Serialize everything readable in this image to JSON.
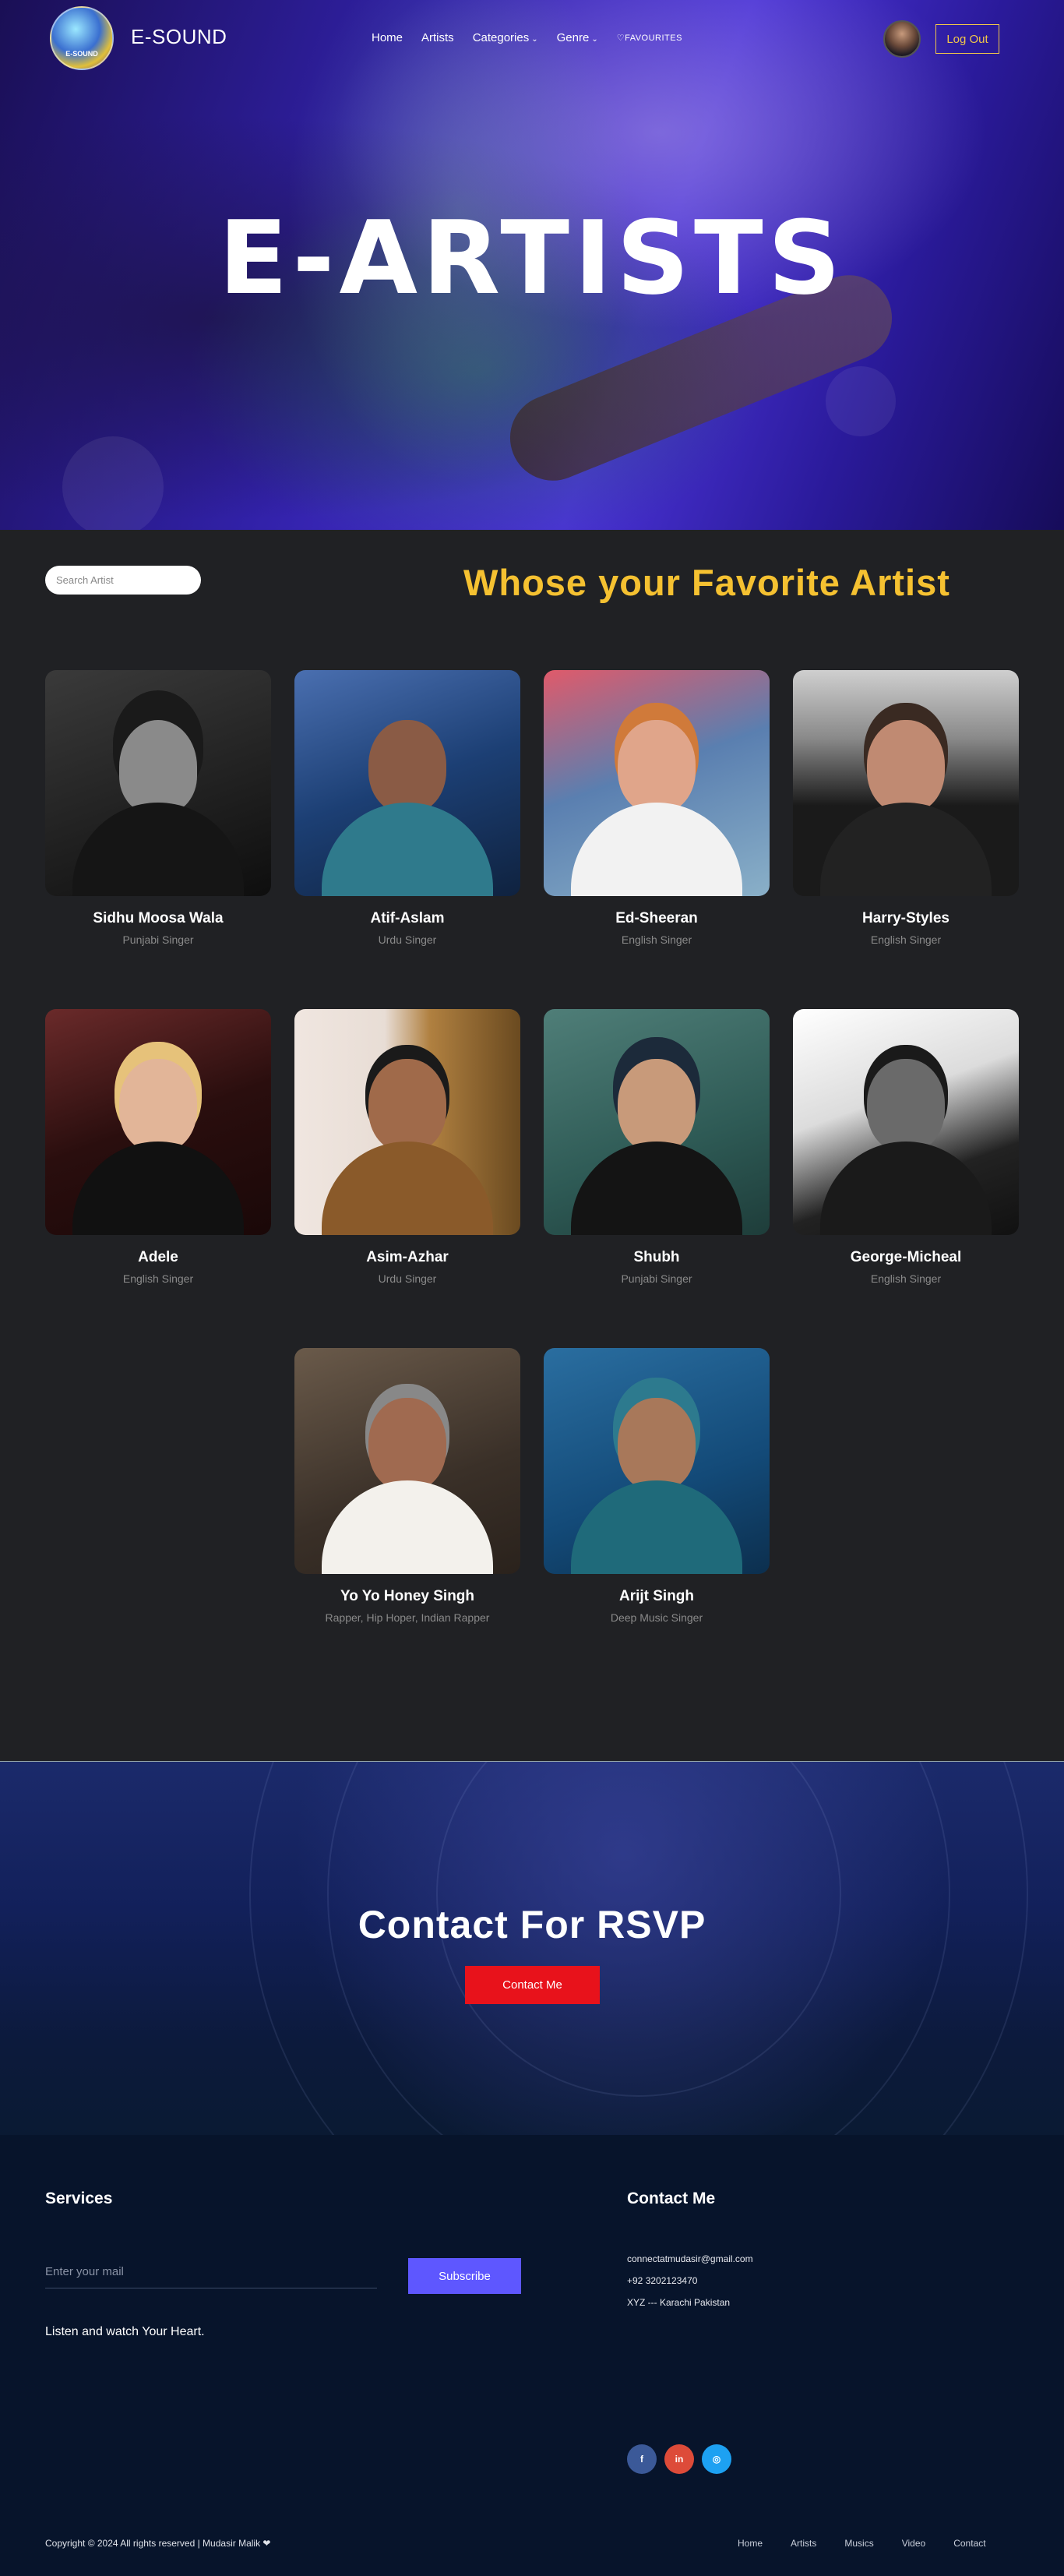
{
  "header": {
    "logo_text": "E-SOUND",
    "brand": "E-SOUND",
    "nav": {
      "home": "Home",
      "artists": "Artists",
      "categories": "Categories",
      "genre": "Genre",
      "favourites": "♡FAVOURITES"
    },
    "logout_label": "Log Out"
  },
  "hero": {
    "title": "E-ARTISTS"
  },
  "artists_section": {
    "search_placeholder": "Search Artist",
    "title": "Whose your Favorite Artist",
    "artists": [
      {
        "name": "Sidhu Moosa Wala",
        "role": "Punjabi Singer"
      },
      {
        "name": "Atif-Aslam",
        "role": "Urdu Singer"
      },
      {
        "name": "Ed-Sheeran",
        "role": "English Singer"
      },
      {
        "name": "Harry-Styles",
        "role": "English Singer"
      },
      {
        "name": "Adele",
        "role": "English Singer"
      },
      {
        "name": "Asim-Azhar",
        "role": "Urdu Singer"
      },
      {
        "name": "Shubh",
        "role": "Punjabi Singer"
      },
      {
        "name": "George-Micheal",
        "role": "English Singer"
      },
      {
        "name": "Yo Yo Honey Singh",
        "role": "Rapper, Hip Hoper, Indian Rapper"
      },
      {
        "name": "Arijt Singh",
        "role": "Deep Music Singer"
      }
    ]
  },
  "contact": {
    "title": "Contact For RSVP",
    "button": "Contact Me"
  },
  "footer": {
    "services_heading": "Services",
    "email_placeholder": "Enter your mail",
    "subscribe": "Subscribe",
    "tagline": "Listen and watch Your Heart.",
    "contact_heading": "Contact Me",
    "email": "connectatmudasir@gmail.com",
    "phone": "+92 3202123470",
    "address": "XYZ --- Karachi Pakistan",
    "social": {
      "facebook": "f",
      "linkedin": "in",
      "instagram": "◎"
    },
    "copyright": "Copyright © 2024 All rights reserved | Mudasir Malik ❤",
    "links": {
      "home": "Home",
      "artists": "Artists",
      "musics": "Musics",
      "video": "Video",
      "contact": "Contact"
    }
  },
  "colors": {
    "accent_yellow": "#f5c131",
    "contact_red": "#e8121b",
    "subscribe_purple": "#5e57ff",
    "page_bg": "#202124",
    "footer_bg": "#07142b"
  }
}
